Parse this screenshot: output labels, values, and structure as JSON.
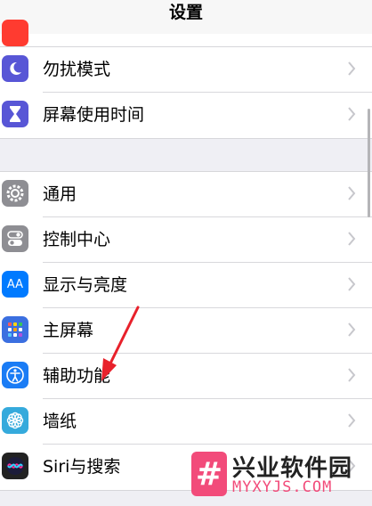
{
  "header": {
    "title": "设置"
  },
  "group1": {
    "items": [
      {
        "label": "勿扰模式",
        "icon": "moon-icon",
        "color": "#5856d6"
      },
      {
        "label": "屏幕使用时间",
        "icon": "hourglass-icon",
        "color": "#5856d6"
      }
    ]
  },
  "group2": {
    "items": [
      {
        "label": "通用",
        "icon": "gear-icon",
        "color": "#8e8e93"
      },
      {
        "label": "控制中心",
        "icon": "toggles-icon",
        "color": "#8e8e93"
      },
      {
        "label": "显示与亮度",
        "icon": "text-size-icon",
        "icon_text": "AA",
        "color": "#007aff"
      },
      {
        "label": "主屏幕",
        "icon": "home-screen-grid-icon",
        "color": "#3b6fe0"
      },
      {
        "label": "辅助功能",
        "icon": "accessibility-person-icon",
        "color": "#1a7cf5"
      },
      {
        "label": "墙纸",
        "icon": "wallpaper-flower-icon",
        "color": "#35aadc"
      },
      {
        "label": "Siri与搜索",
        "icon": "siri-icon",
        "color": "#222"
      }
    ]
  },
  "watermark": {
    "symbol": "#",
    "title": "兴业软件园",
    "url": "MYXYJS.COM",
    "color": "#f24b7a"
  },
  "annotation": {
    "arrow_color": "#e8212b"
  }
}
